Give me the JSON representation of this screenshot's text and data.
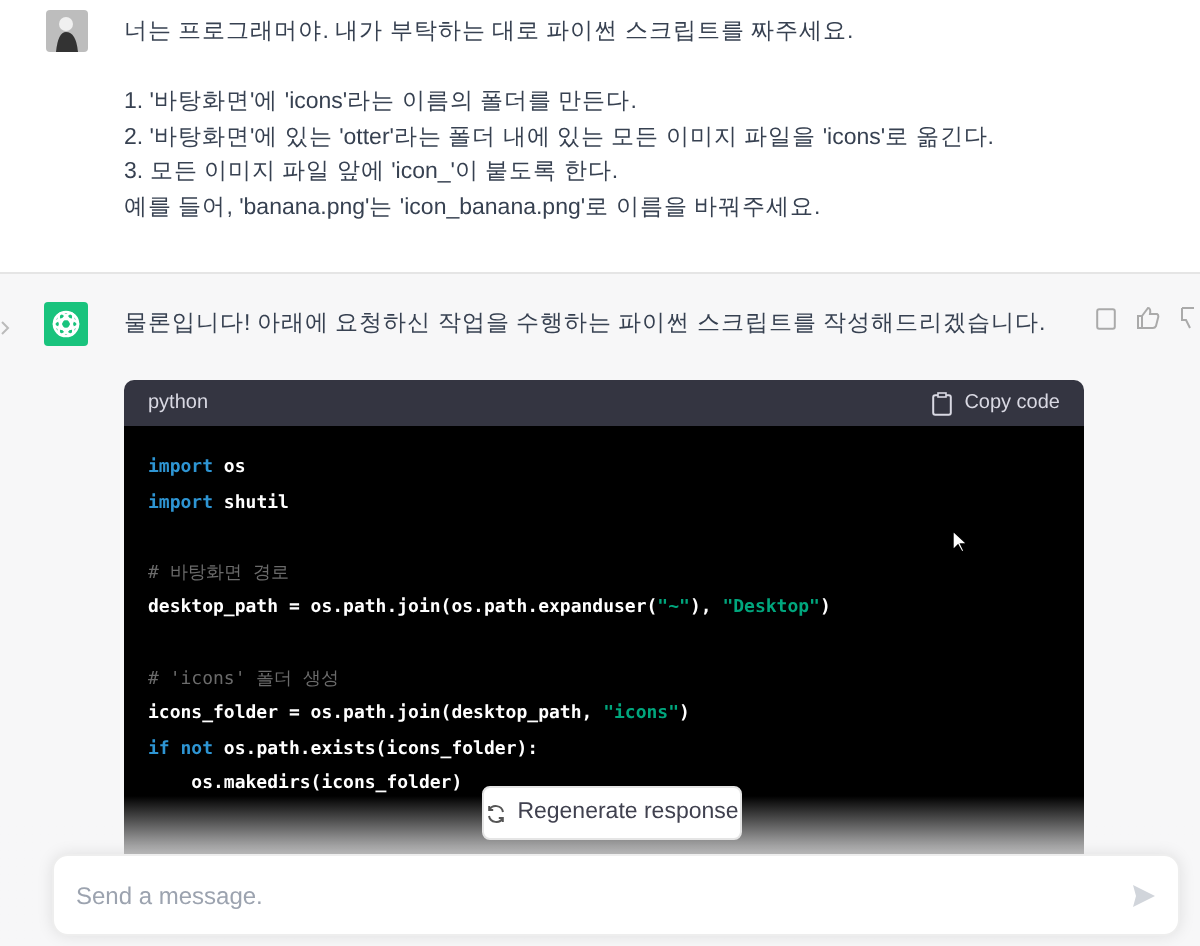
{
  "user_message": {
    "paragraphs": [
      [
        "너는 프로그래머야. 내가 부탁하는 대로 파이썬 스크립트를 짜주세요."
      ],
      [
        "1. '바탕화면'에 'icons'라는 이름의 폴더를 만든다.",
        "2. '바탕화면'에 있는 'otter'라는 폴더 내에 있는 모든 이미지 파일을 'icons'로 옮긴다.",
        "3. 모든 이미지 파일 앞에 'icon_'이 붙도록 한다.",
        "예를 들어, 'banana.png'는 'icon_banana.png'로 이름을 바꿔주세요."
      ]
    ]
  },
  "assistant_message": {
    "text": "물론입니다! 아래에 요청하신 작업을 수행하는 파이썬 스크립트를 작성해드리겠습니다.",
    "code_block": {
      "language": "python",
      "copy_label": "Copy code",
      "blocks": [
        [
          [
            {
              "kind": "keyword",
              "text": "import"
            },
            {
              "kind": "plain",
              "text": " os"
            }
          ],
          [
            {
              "kind": "keyword",
              "text": "import"
            },
            {
              "kind": "plain",
              "text": " shutil"
            }
          ]
        ],
        [
          [
            {
              "kind": "comment",
              "text": "# 바탕화면 경로"
            }
          ],
          [
            {
              "kind": "plain",
              "text": "desktop_path = os.path.join(os.path.expanduser("
            },
            {
              "kind": "string",
              "text": "\"~\""
            },
            {
              "kind": "plain",
              "text": "), "
            },
            {
              "kind": "string",
              "text": "\"Desktop\""
            },
            {
              "kind": "plain",
              "text": ")"
            }
          ]
        ],
        [
          [
            {
              "kind": "comment",
              "text": "# 'icons' 폴더 생성"
            }
          ],
          [
            {
              "kind": "plain",
              "text": "icons_folder = os.path.join(desktop_path, "
            },
            {
              "kind": "string",
              "text": "\"icons\""
            },
            {
              "kind": "plain",
              "text": ")"
            }
          ],
          [
            {
              "kind": "keyword",
              "text": "if not"
            },
            {
              "kind": "plain",
              "text": " os.path.exists(icons_folder):"
            }
          ],
          [
            {
              "kind": "plain",
              "text": "    os.makedirs(icons_folder)"
            }
          ]
        ]
      ]
    }
  },
  "regenerate_button": {
    "label": "Regenerate response"
  },
  "composer": {
    "placeholder": "Send a message."
  }
}
